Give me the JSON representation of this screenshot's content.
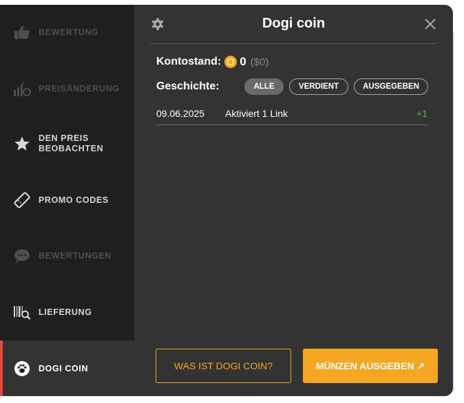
{
  "sidebar": {
    "items": [
      {
        "label": "BEWERTUNG",
        "icon": "thumbs-up-icon"
      },
      {
        "label": "PREISÄNDERUNG",
        "icon": "price-change-icon"
      },
      {
        "label": "DEN PREIS BEOBACHTEN",
        "icon": "star-icon"
      },
      {
        "label": "PROMO CODES",
        "icon": "ticket-icon"
      },
      {
        "label": "BEWERTUNGEN",
        "icon": "chat-bubble-icon"
      },
      {
        "label": "LIEFERUNG",
        "icon": "barcode-search-icon"
      },
      {
        "label": "DOGI COIN",
        "icon": "paw-icon"
      }
    ]
  },
  "panel": {
    "title": "Dogi coin",
    "balance_label": "Kontostand:",
    "balance_value": "0",
    "balance_usd": "($0)",
    "history_label": "Geschichte:",
    "filters": [
      {
        "label": "ALLE",
        "active": true
      },
      {
        "label": "VERDIENT",
        "active": false
      },
      {
        "label": "AUSGEGEBEN",
        "active": false
      }
    ],
    "history": [
      {
        "date": "09.06.2025",
        "description": "Aktiviert 1 Link",
        "delta": "+1"
      }
    ],
    "what_is_button": "WAS IST DOGI COIN?",
    "spend_button": "MÜNZEN AUSGEBEN ↗"
  },
  "colors": {
    "accent": "#f5a623",
    "active_marker": "#e8473a",
    "positive": "#3cc05a"
  }
}
